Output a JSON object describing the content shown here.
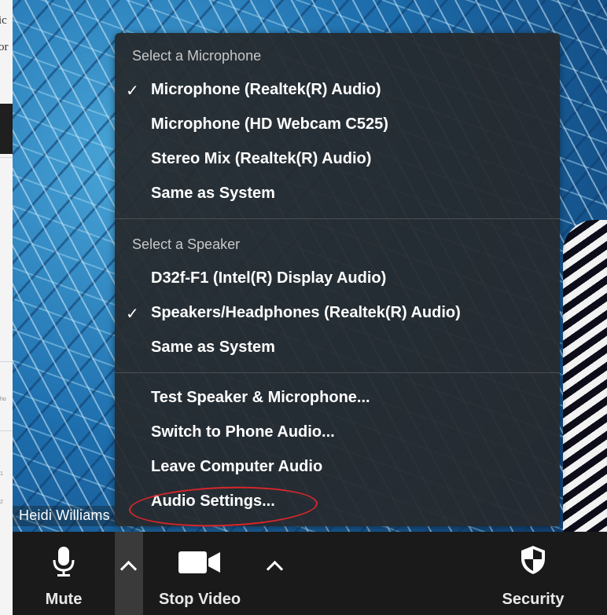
{
  "left_strip": {
    "text1": "ic",
    "text2": "or",
    "tiny1": "ho",
    "tiny2": "1",
    "tiny3": "2"
  },
  "participant_name": "Heidi Williams",
  "audio_menu": {
    "microphone_header": "Select a Microphone",
    "microphones": [
      {
        "label": "Microphone (Realtek(R) Audio)",
        "checked": true
      },
      {
        "label": "Microphone (HD Webcam C525)",
        "checked": false
      },
      {
        "label": "Stereo Mix (Realtek(R) Audio)",
        "checked": false
      },
      {
        "label": "Same as System",
        "checked": false
      }
    ],
    "speaker_header": "Select a Speaker",
    "speakers": [
      {
        "label": "D32f-F1 (Intel(R) Display Audio)",
        "checked": false
      },
      {
        "label": "Speakers/Headphones (Realtek(R) Audio)",
        "checked": true
      },
      {
        "label": "Same as System",
        "checked": false
      }
    ],
    "actions": [
      "Test Speaker & Microphone...",
      "Switch to Phone Audio...",
      "Leave Computer Audio",
      "Audio Settings..."
    ],
    "check_glyph": "✓",
    "highlight_color": "#d8262c"
  },
  "toolbar": {
    "mute_label": "Mute",
    "mute_icon": "microphone-icon",
    "stop_video_label": "Stop Video",
    "video_icon": "video-camera-icon",
    "security_label": "Security",
    "security_icon": "shield-icon"
  }
}
